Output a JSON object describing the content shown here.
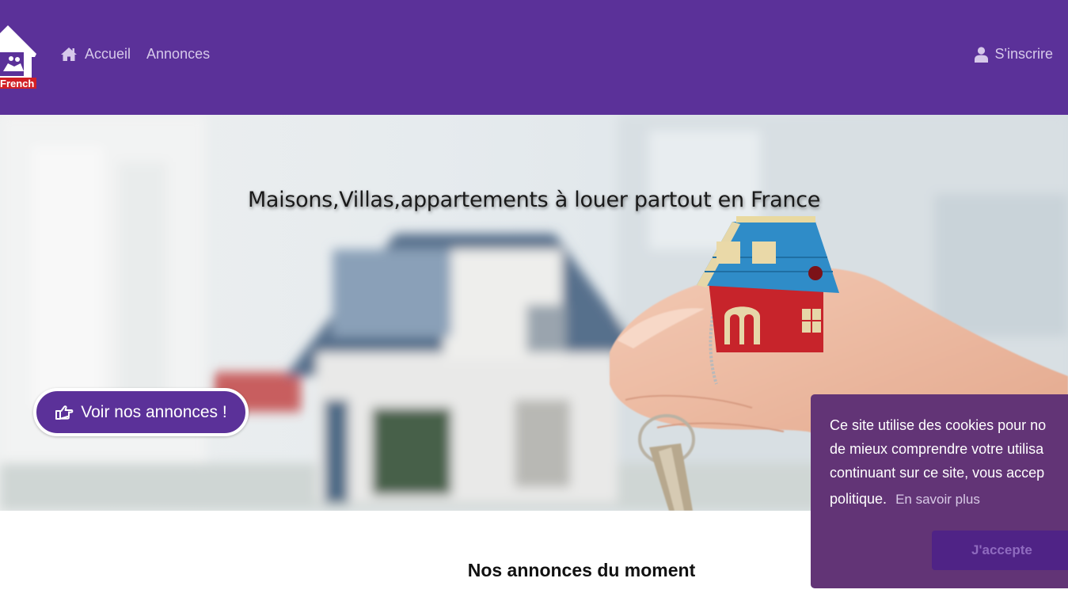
{
  "header": {
    "logo_text": "French",
    "nav": [
      {
        "label": "Accueil",
        "icon": "home-icon"
      },
      {
        "label": "Annonces"
      }
    ],
    "signup_label": "S'inscrire",
    "signup_icon": "user-icon",
    "background": "#5b3199"
  },
  "hero": {
    "title": "Maisons,Villas,appartements à louer partout en France",
    "cta_label": "Voir nos annonces !",
    "cta_icon": "hand-pointer-icon"
  },
  "section": {
    "title": "Nos annonces du moment"
  },
  "cookie": {
    "lines": [
      "Ce site utilise des cookies pour no",
      "de mieux comprendre votre utilisa",
      "continuant sur ce site, vous accep",
      "politique."
    ],
    "link_label": "En savoir plus",
    "accept_label": "J'accepte",
    "background": "#623476"
  }
}
